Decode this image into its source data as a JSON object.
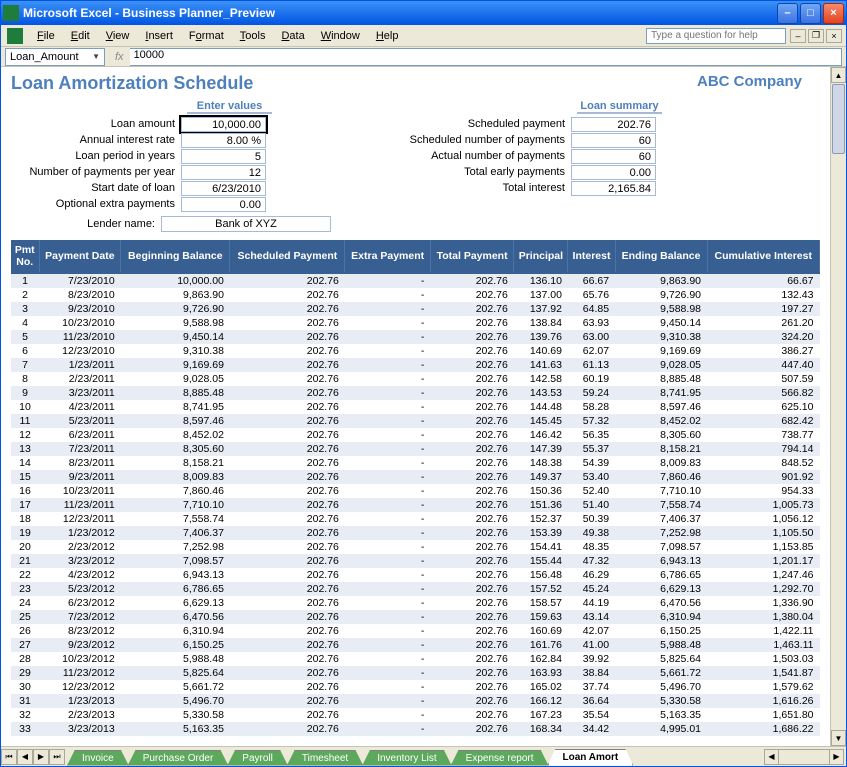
{
  "window": {
    "title": "Microsoft Excel - Business Planner_Preview"
  },
  "menus": {
    "file": "File",
    "edit": "Edit",
    "view": "View",
    "insert": "Insert",
    "format": "Format",
    "tools": "Tools",
    "data": "Data",
    "window": "Window",
    "help": "Help"
  },
  "helpbox_placeholder": "Type a question for help",
  "namebox": "Loan_Amount",
  "formula": "10000",
  "report_title": "Loan Amortization Schedule",
  "company": "ABC Company",
  "enter_values_header": "Enter values",
  "loan_summary_header": "Loan summary",
  "inputs_left": {
    "loan_amount_lbl": "Loan amount",
    "loan_amount_val": "10,000.00",
    "annual_rate_lbl": "Annual interest rate",
    "annual_rate_val": "8.00  %",
    "period_lbl": "Loan period in years",
    "period_val": "5",
    "ppy_lbl": "Number of payments per year",
    "ppy_val": "12",
    "start_lbl": "Start date of loan",
    "start_val": "6/23/2010",
    "extra_lbl": "Optional extra payments",
    "extra_val": "0.00"
  },
  "inputs_right": {
    "sched_pmt_lbl": "Scheduled payment",
    "sched_pmt_val": "202.76",
    "sched_num_lbl": "Scheduled number of payments",
    "sched_num_val": "60",
    "actual_num_lbl": "Actual number of payments",
    "actual_num_val": "60",
    "early_lbl": "Total early payments",
    "early_val": "0.00",
    "interest_lbl": "Total interest",
    "interest_val": "2,165.84"
  },
  "lender_lbl": "Lender name:",
  "lender_val": "Bank of XYZ",
  "headers": {
    "pmt": "Pmt No.",
    "date": "Payment Date",
    "begbal": "Beginning Balance",
    "sched": "Scheduled Payment",
    "extra": "Extra Payment",
    "total": "Total Payment",
    "principal": "Principal",
    "interest": "Interest",
    "endbal": "Ending Balance",
    "cum": "Cumulative Interest"
  },
  "rows": [
    {
      "n": "1",
      "date": "7/23/2010",
      "bb": "10,000.00",
      "sp": "202.76",
      "ep": "-",
      "tp": "202.76",
      "pr": "136.10",
      "in": "66.67",
      "eb": "9,863.90",
      "ci": "66.67"
    },
    {
      "n": "2",
      "date": "8/23/2010",
      "bb": "9,863.90",
      "sp": "202.76",
      "ep": "-",
      "tp": "202.76",
      "pr": "137.00",
      "in": "65.76",
      "eb": "9,726.90",
      "ci": "132.43"
    },
    {
      "n": "3",
      "date": "9/23/2010",
      "bb": "9,726.90",
      "sp": "202.76",
      "ep": "-",
      "tp": "202.76",
      "pr": "137.92",
      "in": "64.85",
      "eb": "9,588.98",
      "ci": "197.27"
    },
    {
      "n": "4",
      "date": "10/23/2010",
      "bb": "9,588.98",
      "sp": "202.76",
      "ep": "-",
      "tp": "202.76",
      "pr": "138.84",
      "in": "63.93",
      "eb": "9,450.14",
      "ci": "261.20"
    },
    {
      "n": "5",
      "date": "11/23/2010",
      "bb": "9,450.14",
      "sp": "202.76",
      "ep": "-",
      "tp": "202.76",
      "pr": "139.76",
      "in": "63.00",
      "eb": "9,310.38",
      "ci": "324.20"
    },
    {
      "n": "6",
      "date": "12/23/2010",
      "bb": "9,310.38",
      "sp": "202.76",
      "ep": "-",
      "tp": "202.76",
      "pr": "140.69",
      "in": "62.07",
      "eb": "9,169.69",
      "ci": "386.27"
    },
    {
      "n": "7",
      "date": "1/23/2011",
      "bb": "9,169.69",
      "sp": "202.76",
      "ep": "-",
      "tp": "202.76",
      "pr": "141.63",
      "in": "61.13",
      "eb": "9,028.05",
      "ci": "447.40"
    },
    {
      "n": "8",
      "date": "2/23/2011",
      "bb": "9,028.05",
      "sp": "202.76",
      "ep": "-",
      "tp": "202.76",
      "pr": "142.58",
      "in": "60.19",
      "eb": "8,885.48",
      "ci": "507.59"
    },
    {
      "n": "9",
      "date": "3/23/2011",
      "bb": "8,885.48",
      "sp": "202.76",
      "ep": "-",
      "tp": "202.76",
      "pr": "143.53",
      "in": "59.24",
      "eb": "8,741.95",
      "ci": "566.82"
    },
    {
      "n": "10",
      "date": "4/23/2011",
      "bb": "8,741.95",
      "sp": "202.76",
      "ep": "-",
      "tp": "202.76",
      "pr": "144.48",
      "in": "58.28",
      "eb": "8,597.46",
      "ci": "625.10"
    },
    {
      "n": "11",
      "date": "5/23/2011",
      "bb": "8,597.46",
      "sp": "202.76",
      "ep": "-",
      "tp": "202.76",
      "pr": "145.45",
      "in": "57.32",
      "eb": "8,452.02",
      "ci": "682.42"
    },
    {
      "n": "12",
      "date": "6/23/2011",
      "bb": "8,452.02",
      "sp": "202.76",
      "ep": "-",
      "tp": "202.76",
      "pr": "146.42",
      "in": "56.35",
      "eb": "8,305.60",
      "ci": "738.77"
    },
    {
      "n": "13",
      "date": "7/23/2011",
      "bb": "8,305.60",
      "sp": "202.76",
      "ep": "-",
      "tp": "202.76",
      "pr": "147.39",
      "in": "55.37",
      "eb": "8,158.21",
      "ci": "794.14"
    },
    {
      "n": "14",
      "date": "8/23/2011",
      "bb": "8,158.21",
      "sp": "202.76",
      "ep": "-",
      "tp": "202.76",
      "pr": "148.38",
      "in": "54.39",
      "eb": "8,009.83",
      "ci": "848.52"
    },
    {
      "n": "15",
      "date": "9/23/2011",
      "bb": "8,009.83",
      "sp": "202.76",
      "ep": "-",
      "tp": "202.76",
      "pr": "149.37",
      "in": "53.40",
      "eb": "7,860.46",
      "ci": "901.92"
    },
    {
      "n": "16",
      "date": "10/23/2011",
      "bb": "7,860.46",
      "sp": "202.76",
      "ep": "-",
      "tp": "202.76",
      "pr": "150.36",
      "in": "52.40",
      "eb": "7,710.10",
      "ci": "954.33"
    },
    {
      "n": "17",
      "date": "11/23/2011",
      "bb": "7,710.10",
      "sp": "202.76",
      "ep": "-",
      "tp": "202.76",
      "pr": "151.36",
      "in": "51.40",
      "eb": "7,558.74",
      "ci": "1,005.73"
    },
    {
      "n": "18",
      "date": "12/23/2011",
      "bb": "7,558.74",
      "sp": "202.76",
      "ep": "-",
      "tp": "202.76",
      "pr": "152.37",
      "in": "50.39",
      "eb": "7,406.37",
      "ci": "1,056.12"
    },
    {
      "n": "19",
      "date": "1/23/2012",
      "bb": "7,406.37",
      "sp": "202.76",
      "ep": "-",
      "tp": "202.76",
      "pr": "153.39",
      "in": "49.38",
      "eb": "7,252.98",
      "ci": "1,105.50"
    },
    {
      "n": "20",
      "date": "2/23/2012",
      "bb": "7,252.98",
      "sp": "202.76",
      "ep": "-",
      "tp": "202.76",
      "pr": "154.41",
      "in": "48.35",
      "eb": "7,098.57",
      "ci": "1,153.85"
    },
    {
      "n": "21",
      "date": "3/23/2012",
      "bb": "7,098.57",
      "sp": "202.76",
      "ep": "-",
      "tp": "202.76",
      "pr": "155.44",
      "in": "47.32",
      "eb": "6,943.13",
      "ci": "1,201.17"
    },
    {
      "n": "22",
      "date": "4/23/2012",
      "bb": "6,943.13",
      "sp": "202.76",
      "ep": "-",
      "tp": "202.76",
      "pr": "156.48",
      "in": "46.29",
      "eb": "6,786.65",
      "ci": "1,247.46"
    },
    {
      "n": "23",
      "date": "5/23/2012",
      "bb": "6,786.65",
      "sp": "202.76",
      "ep": "-",
      "tp": "202.76",
      "pr": "157.52",
      "in": "45.24",
      "eb": "6,629.13",
      "ci": "1,292.70"
    },
    {
      "n": "24",
      "date": "6/23/2012",
      "bb": "6,629.13",
      "sp": "202.76",
      "ep": "-",
      "tp": "202.76",
      "pr": "158.57",
      "in": "44.19",
      "eb": "6,470.56",
      "ci": "1,336.90"
    },
    {
      "n": "25",
      "date": "7/23/2012",
      "bb": "6,470.56",
      "sp": "202.76",
      "ep": "-",
      "tp": "202.76",
      "pr": "159.63",
      "in": "43.14",
      "eb": "6,310.94",
      "ci": "1,380.04"
    },
    {
      "n": "26",
      "date": "8/23/2012",
      "bb": "6,310.94",
      "sp": "202.76",
      "ep": "-",
      "tp": "202.76",
      "pr": "160.69",
      "in": "42.07",
      "eb": "6,150.25",
      "ci": "1,422.11"
    },
    {
      "n": "27",
      "date": "9/23/2012",
      "bb": "6,150.25",
      "sp": "202.76",
      "ep": "-",
      "tp": "202.76",
      "pr": "161.76",
      "in": "41.00",
      "eb": "5,988.48",
      "ci": "1,463.11"
    },
    {
      "n": "28",
      "date": "10/23/2012",
      "bb": "5,988.48",
      "sp": "202.76",
      "ep": "-",
      "tp": "202.76",
      "pr": "162.84",
      "in": "39.92",
      "eb": "5,825.64",
      "ci": "1,503.03"
    },
    {
      "n": "29",
      "date": "11/23/2012",
      "bb": "5,825.64",
      "sp": "202.76",
      "ep": "-",
      "tp": "202.76",
      "pr": "163.93",
      "in": "38.84",
      "eb": "5,661.72",
      "ci": "1,541.87"
    },
    {
      "n": "30",
      "date": "12/23/2012",
      "bb": "5,661.72",
      "sp": "202.76",
      "ep": "-",
      "tp": "202.76",
      "pr": "165.02",
      "in": "37.74",
      "eb": "5,496.70",
      "ci": "1,579.62"
    },
    {
      "n": "31",
      "date": "1/23/2013",
      "bb": "5,496.70",
      "sp": "202.76",
      "ep": "-",
      "tp": "202.76",
      "pr": "166.12",
      "in": "36.64",
      "eb": "5,330.58",
      "ci": "1,616.26"
    },
    {
      "n": "32",
      "date": "2/23/2013",
      "bb": "5,330.58",
      "sp": "202.76",
      "ep": "-",
      "tp": "202.76",
      "pr": "167.23",
      "in": "35.54",
      "eb": "5,163.35",
      "ci": "1,651.80"
    },
    {
      "n": "33",
      "date": "3/23/2013",
      "bb": "5,163.35",
      "sp": "202.76",
      "ep": "-",
      "tp": "202.76",
      "pr": "168.34",
      "in": "34.42",
      "eb": "4,995.01",
      "ci": "1,686.22"
    }
  ],
  "tabs": {
    "invoice": "Invoice",
    "po": "Purchase Order",
    "payroll": "Payroll",
    "timesheet": "Timesheet",
    "inventory": "Inventory List",
    "expense": "Expense report",
    "loan": "Loan Amort"
  }
}
